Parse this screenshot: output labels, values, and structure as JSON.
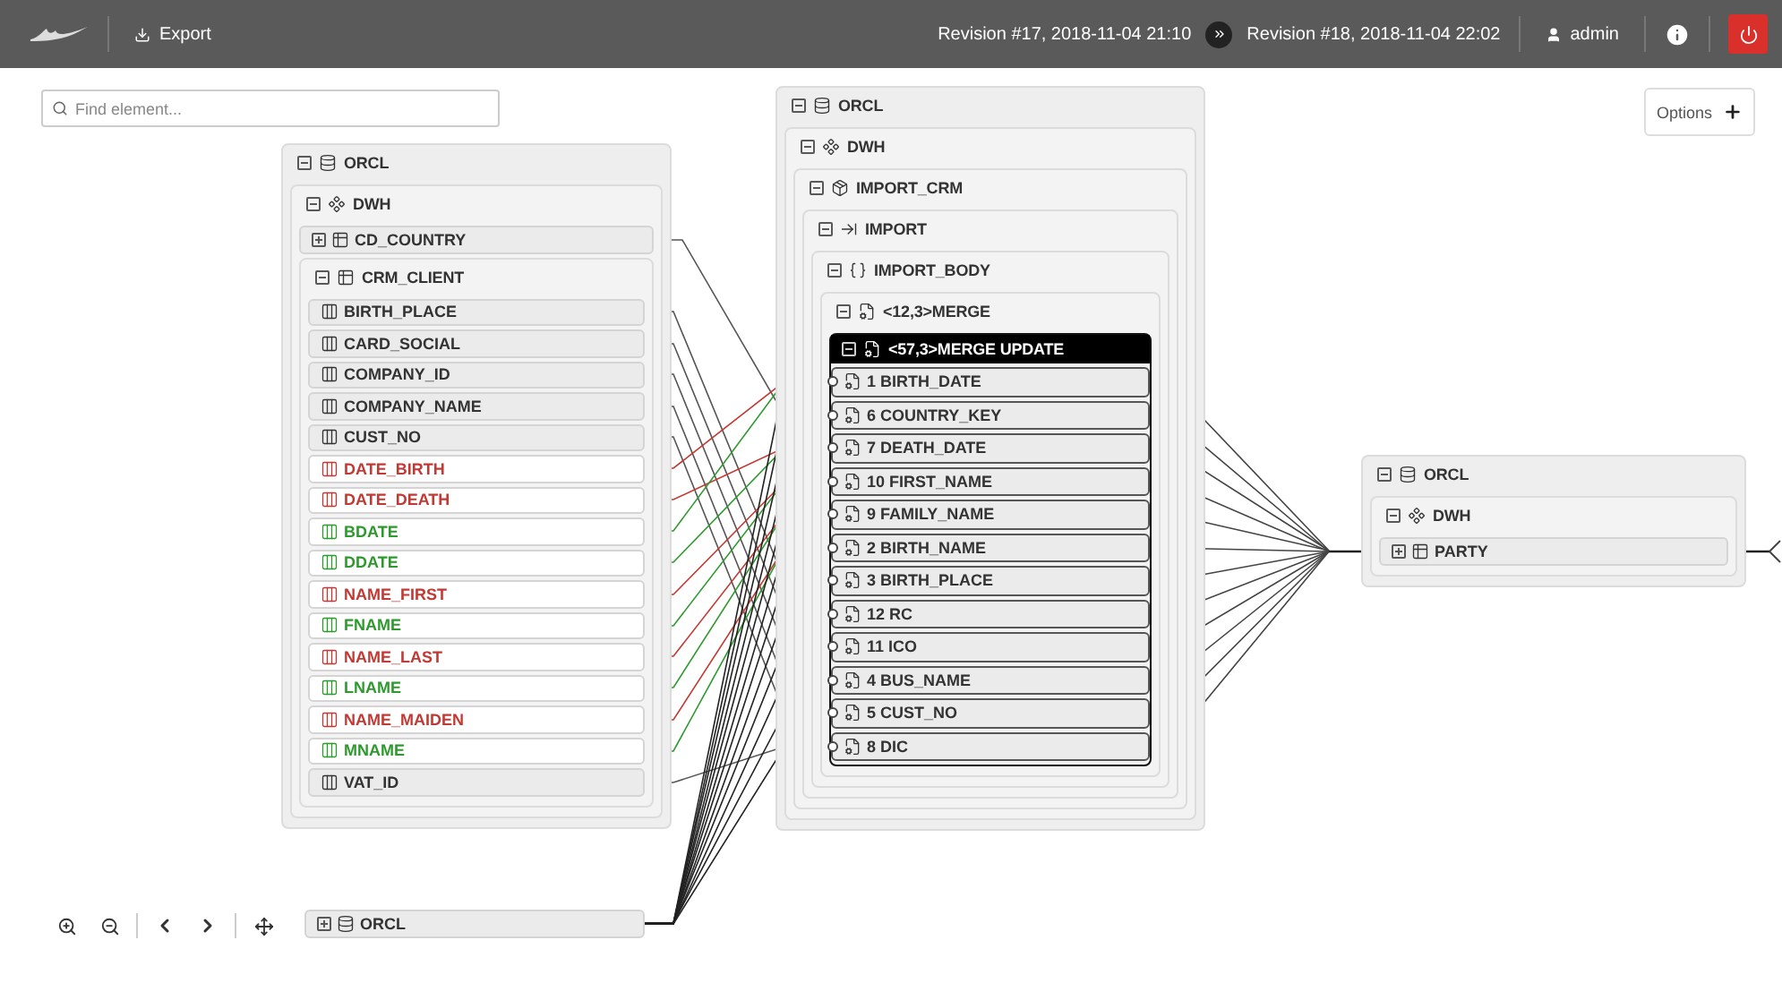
{
  "toolbar": {
    "export": "Export",
    "revision_from": "Revision #17, 2018-11-04 21:10",
    "revision_to": "Revision #18, 2018-11-04 22:02",
    "user": "admin"
  },
  "search": {
    "placeholder": "Find element..."
  },
  "options": "Options",
  "source_panel": [
    {
      "label": "ORCL",
      "kind": "database",
      "expanded": true,
      "children": [
        {
          "label": "DWH",
          "kind": "schema",
          "expanded": true,
          "children": [
            {
              "label": "CD_COUNTRY",
              "kind": "table",
              "expanded": false
            },
            {
              "label": "CRM_CLIENT",
              "kind": "table",
              "expanded": true,
              "children": [
                {
                  "label": "BIRTH_PLACE",
                  "kind": "column",
                  "removed": false,
                  "added": false
                },
                {
                  "label": "CARD_SOCIAL",
                  "kind": "column",
                  "removed": false,
                  "added": false
                },
                {
                  "label": "COMPANY_ID",
                  "kind": "column",
                  "removed": false,
                  "added": false
                },
                {
                  "label": "COMPANY_NAME",
                  "kind": "column",
                  "removed": false,
                  "added": false
                },
                {
                  "label": "CUST_NO",
                  "kind": "column",
                  "removed": false,
                  "added": false
                },
                {
                  "label": "DATE_BIRTH",
                  "kind": "column",
                  "removed": true,
                  "added": false
                },
                {
                  "label": "DATE_DEATH",
                  "kind": "column",
                  "removed": true,
                  "added": false
                },
                {
                  "label": "BDATE",
                  "kind": "column",
                  "removed": false,
                  "added": true
                },
                {
                  "label": "DDATE",
                  "kind": "column",
                  "removed": false,
                  "added": true
                },
                {
                  "label": "NAME_FIRST",
                  "kind": "column",
                  "removed": true,
                  "added": false
                },
                {
                  "label": "FNAME",
                  "kind": "column",
                  "removed": false,
                  "added": true
                },
                {
                  "label": "NAME_LAST",
                  "kind": "column",
                  "removed": true,
                  "added": false
                },
                {
                  "label": "LNAME",
                  "kind": "column",
                  "removed": false,
                  "added": true
                },
                {
                  "label": "NAME_MAIDEN",
                  "kind": "column",
                  "removed": true,
                  "added": false
                },
                {
                  "label": "MNAME",
                  "kind": "column",
                  "removed": false,
                  "added": true
                },
                {
                  "label": "VAT_ID",
                  "kind": "column",
                  "removed": false,
                  "added": false
                }
              ]
            }
          ]
        }
      ]
    },
    {
      "label": "ORCL",
      "kind": "database",
      "expanded": false
    }
  ],
  "process_panel": [
    {
      "label": "ORCL",
      "kind": "database",
      "expanded": true,
      "children": [
        {
          "label": "DWH",
          "kind": "schema",
          "expanded": true,
          "children": [
            {
              "label": "IMPORT_CRM",
              "kind": "package",
              "expanded": true,
              "children": [
                {
                  "label": "IMPORT",
                  "kind": "procedure",
                  "expanded": true,
                  "children": [
                    {
                      "label": "IMPORT_BODY",
                      "kind": "block",
                      "expanded": true,
                      "children": [
                        {
                          "label": "<12,3>MERGE",
                          "kind": "statement",
                          "expanded": true,
                          "selected": false,
                          "children": [
                            {
                              "label": "<57,3>MERGE UPDATE",
                              "kind": "statement",
                              "expanded": true,
                              "selected": true,
                              "children": [
                                {
                                  "label": "1 BIRTH_DATE",
                                  "kind": "output"
                                },
                                {
                                  "label": "6 COUNTRY_KEY",
                                  "kind": "output"
                                },
                                {
                                  "label": "7 DEATH_DATE",
                                  "kind": "output"
                                },
                                {
                                  "label": "10 FIRST_NAME",
                                  "kind": "output"
                                },
                                {
                                  "label": "9 FAMILY_NAME",
                                  "kind": "output"
                                },
                                {
                                  "label": "2 BIRTH_NAME",
                                  "kind": "output"
                                },
                                {
                                  "label": "3 BIRTH_PLACE",
                                  "kind": "output"
                                },
                                {
                                  "label": "12 RC",
                                  "kind": "output"
                                },
                                {
                                  "label": "11 ICO",
                                  "kind": "output"
                                },
                                {
                                  "label": "4 BUS_NAME",
                                  "kind": "output"
                                },
                                {
                                  "label": "5 CUST_NO",
                                  "kind": "output"
                                },
                                {
                                  "label": "8 DIC",
                                  "kind": "output"
                                }
                              ]
                            }
                          ]
                        }
                      ]
                    }
                  ]
                }
              ]
            }
          ]
        }
      ]
    }
  ],
  "target_panel": [
    {
      "label": "ORCL",
      "kind": "database",
      "expanded": true,
      "children": [
        {
          "label": "DWH",
          "kind": "schema",
          "expanded": true,
          "children": [
            {
              "label": "PARTY",
              "kind": "table",
              "expanded": false
            }
          ]
        }
      ]
    }
  ]
}
